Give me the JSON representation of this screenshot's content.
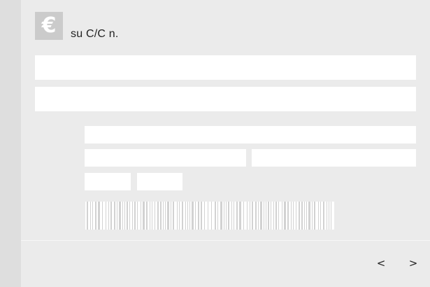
{
  "header": {
    "currency_symbol": "€",
    "text": "su C/C n."
  },
  "form": {
    "field_1": {
      "value": ""
    },
    "field_2": {
      "value": ""
    },
    "field_3": {
      "value": ""
    },
    "field_4": {
      "value": ""
    },
    "field_5": {
      "value": ""
    },
    "field_6": {
      "value": ""
    },
    "field_7": {
      "value": ""
    }
  },
  "navigation": {
    "prev_label": "<",
    "next_label": ">"
  },
  "icons": {
    "currency": "euro-icon",
    "barcode": "barcode-icon"
  }
}
